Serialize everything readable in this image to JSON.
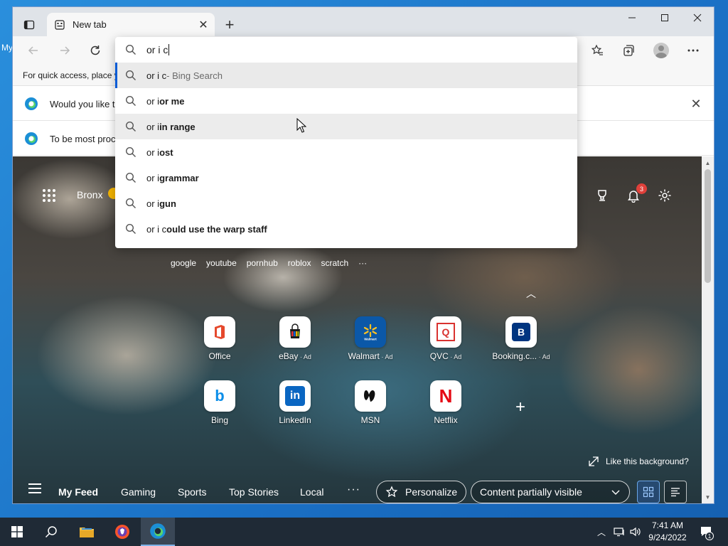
{
  "desktop": {
    "edge_text": "My"
  },
  "browser": {
    "tab": {
      "title": "New tab"
    },
    "favorites_bar": {
      "text": "For quick access, place y"
    },
    "infobars": [
      {
        "message": "Would you like t"
      },
      {
        "message": "To be most proc"
      }
    ]
  },
  "omnibox": {
    "value": "or i c",
    "suggestions": [
      {
        "pre": "or i c",
        "suf": "",
        "engine": " - Bing Search"
      },
      {
        "pre": "or i ",
        "suf": "or me",
        "engine": ""
      },
      {
        "pre": "or i ",
        "suf": "in range",
        "engine": ""
      },
      {
        "pre": "or i ",
        "suf": "ost",
        "engine": ""
      },
      {
        "pre": "or i ",
        "suf": "grammar",
        "engine": ""
      },
      {
        "pre": "or i ",
        "suf": "gun",
        "engine": ""
      },
      {
        "pre": "or i c",
        "suf": "ould use the warp staff",
        "engine": ""
      }
    ]
  },
  "ntp": {
    "location": "Bronx",
    "notifications_count": "3",
    "quick_searches": [
      "google",
      "youtube",
      "pornhub",
      "roblox",
      "scratch"
    ],
    "more": "···",
    "tiles": [
      {
        "label": "Office",
        "ad": ""
      },
      {
        "label": "eBay",
        "ad": " · Ad"
      },
      {
        "label": "Walmart",
        "ad": " · Ad"
      },
      {
        "label": "QVC",
        "ad": " · Ad"
      },
      {
        "label": "Booking.c...",
        "ad": " · Ad"
      },
      {
        "label": "Bing",
        "ad": ""
      },
      {
        "label": "LinkedIn",
        "ad": ""
      },
      {
        "label": "MSN",
        "ad": ""
      },
      {
        "label": "Netflix",
        "ad": ""
      }
    ],
    "tile_glyphs": {
      "walmart": "Walmart",
      "qvc": "Q",
      "booking": "B",
      "linkedin": "in",
      "netflix": "N",
      "bing": "b"
    },
    "like_background": "Like this background?",
    "feed": {
      "tabs": [
        "My Feed",
        "Gaming",
        "Sports",
        "Top Stories",
        "Local"
      ],
      "more": "···",
      "personalize": "Personalize",
      "visibility": "Content partially visible"
    }
  },
  "taskbar": {
    "time": "7:41 AM",
    "date": "9/24/2022",
    "notification_count": "1"
  },
  "colors": {
    "accent": "#0b5cd6",
    "taskbar": "#1f2a36",
    "badge": "#e0403a"
  }
}
